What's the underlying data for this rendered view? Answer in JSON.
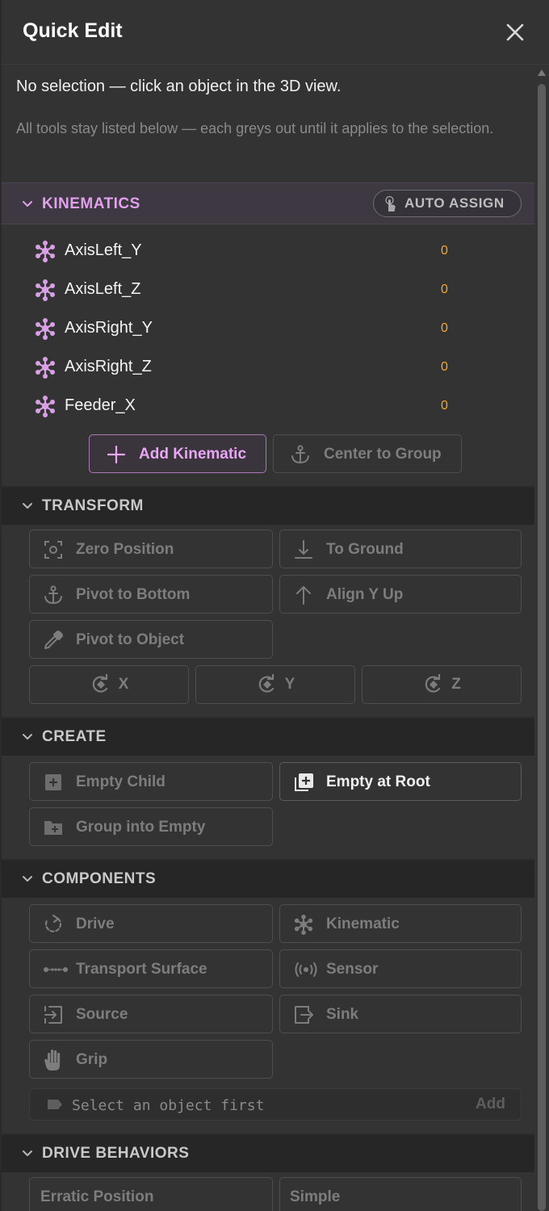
{
  "header": {
    "title": "Quick Edit"
  },
  "info": {
    "line1": "No selection — click an object in the 3D view.",
    "line2": "All tools stay listed below — each greys out until it applies to the selection."
  },
  "kinematics": {
    "label": "KINEMATICS",
    "auto_assign": "AUTO ASSIGN",
    "items": [
      {
        "name": "AxisLeft_Y",
        "value": "0"
      },
      {
        "name": "AxisLeft_Z",
        "value": "0"
      },
      {
        "name": "AxisRight_Y",
        "value": "0"
      },
      {
        "name": "AxisRight_Z",
        "value": "0"
      },
      {
        "name": "Feeder_X",
        "value": "0"
      }
    ],
    "add_kinematic": "Add Kinematic",
    "center_to_group": "Center to Group"
  },
  "transform": {
    "label": "TRANSFORM",
    "zero_position": "Zero Position",
    "to_ground": "To Ground",
    "pivot_to_bottom": "Pivot to Bottom",
    "align_y_up": "Align Y Up",
    "pivot_to_object": "Pivot to Object",
    "rot_x": "X",
    "rot_y": "Y",
    "rot_z": "Z"
  },
  "create": {
    "label": "CREATE",
    "empty_child": "Empty Child",
    "empty_at_root": "Empty at Root",
    "group_into_empty": "Group into Empty"
  },
  "components": {
    "label": "COMPONENTS",
    "drive": "Drive",
    "kinematic": "Kinematic",
    "transport_surface": "Transport Surface",
    "sensor": "Sensor",
    "source": "Source",
    "sink": "Sink",
    "grip": "Grip",
    "input_placeholder": "Select an object first",
    "add": "Add"
  },
  "drive_behaviors": {
    "label": "DRIVE BEHAVIORS",
    "erratic_position": "Erratic Position",
    "simple": "Simple"
  },
  "colors": {
    "accent": "#e0a0ec",
    "value": "#f0a830",
    "panel": "#333333"
  }
}
